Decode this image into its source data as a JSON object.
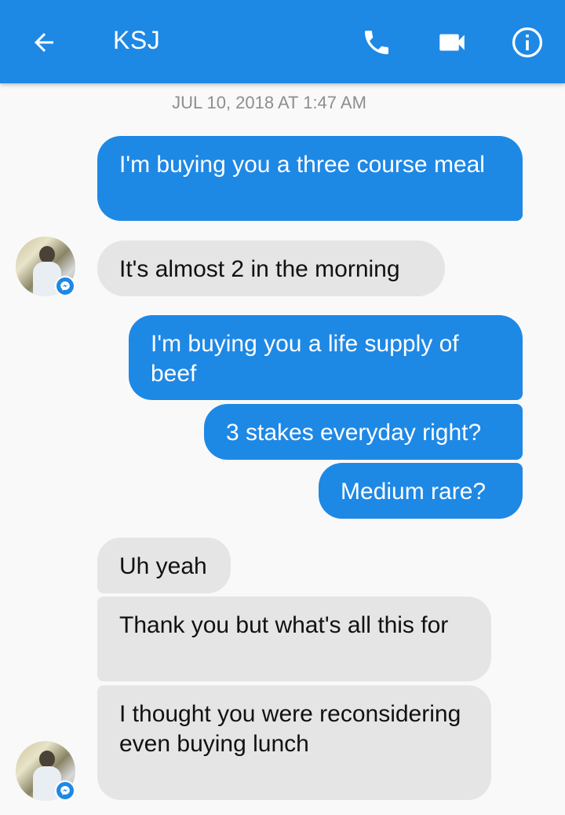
{
  "header": {
    "contact_name": "KSJ",
    "icons": [
      "arrow-back-icon",
      "phone-icon",
      "video-camera-icon",
      "info-icon"
    ]
  },
  "conversation": {
    "timestamp": "JUL 10, 2018 AT 1:47 AM",
    "messages": [
      {
        "sender": "me",
        "text": "I'm buying you a three course meal"
      },
      {
        "sender": "contact",
        "text": "It's almost 2 in the morning"
      },
      {
        "sender": "me",
        "text": "I'm buying you a life supply of beef"
      },
      {
        "sender": "me",
        "text": "3 stakes everyday right?"
      },
      {
        "sender": "me",
        "text": "Medium rare?"
      },
      {
        "sender": "contact",
        "text": "Uh yeah"
      },
      {
        "sender": "contact",
        "text": "Thank you but what's all this for"
      },
      {
        "sender": "contact",
        "text": "I thought you were reconsidering even buying lunch"
      }
    ]
  },
  "colors": {
    "accent": "#1e88e5",
    "outgoing_bubble": "#1e88e5",
    "incoming_bubble": "#e5e5e5",
    "background": "#f9f9f9"
  }
}
